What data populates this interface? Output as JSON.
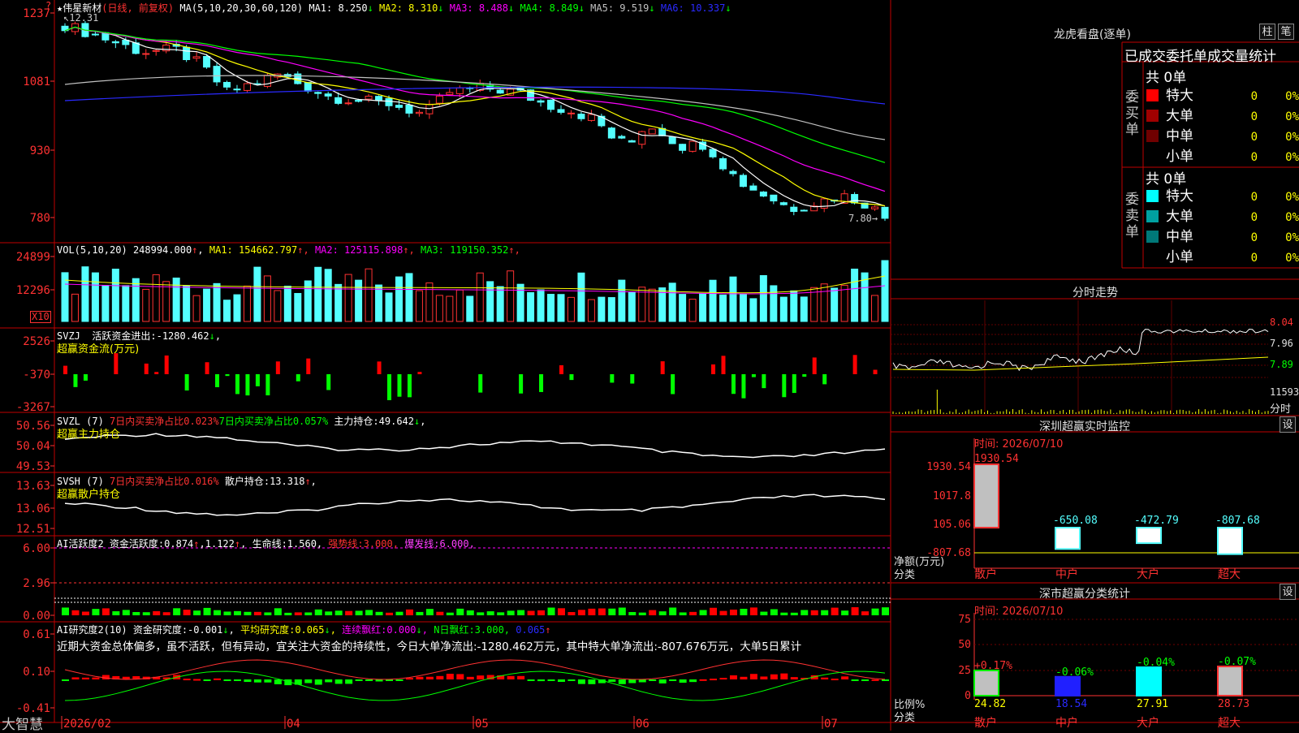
{
  "colors": {
    "up": "#ff3232",
    "down": "#54ffff",
    "ma1": "#ffffff",
    "ma2": "#ffff00",
    "ma3": "#ff00ff",
    "ma4": "#00ff00",
    "ma5": "#c0c0c0",
    "ma6": "#2a2aff",
    "frame": "#c00000",
    "axis": "#ff3232"
  },
  "main_panel": {
    "stock_name": "伟星新材",
    "period_adjust": "(日线, 前复权)",
    "ma_header": "MA(5,10,20,30,60,120)",
    "ma": [
      {
        "label": "MA1:",
        "value": "8.250",
        "arrow": "↓",
        "color": "#ffffff"
      },
      {
        "label": "MA2:",
        "value": "8.310",
        "arrow": "↓",
        "color": "#ffff00"
      },
      {
        "label": "MA3:",
        "value": "8.488",
        "arrow": "↓",
        "color": "#ff00ff"
      },
      {
        "label": "MA4:",
        "value": "8.849",
        "arrow": "↓",
        "color": "#00ff00"
      },
      {
        "label": "MA5:",
        "value": "9.519",
        "arrow": "↓",
        "color": "#c0c0c0"
      },
      {
        "label": "MA6:",
        "value": "10.337",
        "arrow": "↓",
        "color": "#2a2aff"
      }
    ],
    "high_marker": "12.31",
    "low_marker": "7.80→",
    "y_ticks": [
      "1237",
      "1081",
      "930",
      "780"
    ],
    "top_left_icon": "?"
  },
  "vol_panel": {
    "title": "VOL(5,10,20)",
    "value": "248994.000",
    "ma": [
      {
        "label": "MA1:",
        "value": "154662.797",
        "color": "#ffff00"
      },
      {
        "label": "MA2:",
        "value": "125115.898",
        "color": "#ff00ff"
      },
      {
        "label": "MA3:",
        "value": "119150.352",
        "color": "#00ff00"
      }
    ],
    "y_ticks": [
      "24899",
      "12296"
    ],
    "unit": "X10"
  },
  "svzj_panel": {
    "title": "SVZJ",
    "label": "活跃资金进出:",
    "value": "-1280.462",
    "subtitle": "超赢资金流(万元)",
    "y_ticks": [
      "2526",
      "-370",
      "-3267"
    ]
  },
  "svzl_panel": {
    "title": "SVZL (7)",
    "label1": "7日内买卖净占比0.023%",
    "label2": "7日内买卖净占比0.057%",
    "label3": "主力持仓:",
    "value": "49.642",
    "subtitle": "超赢主力持仓",
    "y_ticks": [
      "50.56",
      "50.04",
      "49.53"
    ]
  },
  "svsh_panel": {
    "title": "SVSH (7)",
    "label1": "7日内买卖净占比0.016%",
    "label2": "散户持仓:",
    "value": "13.318",
    "subtitle": "超赢散户持仓",
    "y_ticks": [
      "13.63",
      "13.06",
      "12.51"
    ]
  },
  "ai1_panel": {
    "title": "AI活跃度2",
    "label": "资金活跃度:",
    "value1": "0.874",
    "value2": "1.122",
    "life_label": "生命线:",
    "life_value": "1.560",
    "strong_label": "强势线:",
    "strong_value": "3.000",
    "burst_label": "爆发线:",
    "burst_value": "6.000",
    "y_ticks": [
      "6.00",
      "2.96",
      "0.00"
    ]
  },
  "ai2_panel": {
    "title": "AI研究度2(10)",
    "label1": "资金研究度:",
    "value1": "-0.001",
    "label2": "平均研究度:",
    "value2": "0.065",
    "label3": "连续飘红:",
    "value3": "0.000",
    "label4": "N日飘红:",
    "value4": "3.000",
    "value5": "0.065",
    "commentary": "近期大资金总体偏多，虽不活跃，但有异动，宜关注大资金的持续性，今日大单净流出:-1280.462万元，其中特大单净流出:-807.676万元，大单5日累计",
    "y_ticks": [
      "0.61",
      "0.10",
      "-0.41"
    ]
  },
  "x_axis": {
    "labels": [
      "2026/02",
      "04",
      "05",
      "06",
      "07"
    ],
    "brand": "大智慧"
  },
  "dragon": {
    "title": "龙虎看盘(逐单)",
    "btn_bar": "柱",
    "btn_pen": "笔",
    "header": "已成交委托单成交量统计",
    "buy_label": "委买单",
    "sell_label": "委卖单",
    "buy_total": "共 0单",
    "sell_total": "共 0单",
    "buy_rows": [
      {
        "label": "特大",
        "count": "0",
        "pct": "0%",
        "color": "#ff0000"
      },
      {
        "label": "大单",
        "count": "0",
        "pct": "0%",
        "color": "#a00000"
      },
      {
        "label": "中单",
        "count": "0",
        "pct": "0%",
        "color": "#700000"
      },
      {
        "label": "小单",
        "count": "0",
        "pct": "0%",
        "color": ""
      }
    ],
    "sell_rows": [
      {
        "label": "特大",
        "count": "0",
        "pct": "0%",
        "color": "#00ffff"
      },
      {
        "label": "大单",
        "count": "0",
        "pct": "0%",
        "color": "#00a0a0"
      },
      {
        "label": "中单",
        "count": "0",
        "pct": "0%",
        "color": "#007878"
      },
      {
        "label": "小单",
        "count": "0",
        "pct": "0%",
        "color": ""
      }
    ]
  },
  "intraday": {
    "title": "分时走势",
    "y_ticks": [
      "8.04",
      "7.96",
      "7.89"
    ],
    "vol_tick": "11593",
    "vol_label": "分时"
  },
  "sz_monitor": {
    "title": "深圳超赢实时监控",
    "btn": "设",
    "time": "时间: 2026/07/10",
    "y_ticks": [
      "1930.54",
      "1017.8",
      "105.06",
      "-807.68"
    ],
    "bars": [
      {
        "cat": "散户",
        "value": 1930.54,
        "label": "1930.54"
      },
      {
        "cat": "中户",
        "value": -650.08,
        "label": "-650.08"
      },
      {
        "cat": "大户",
        "value": -472.79,
        "label": "-472.79"
      },
      {
        "cat": "超大",
        "value": -807.68,
        "label": "-807.68"
      }
    ],
    "axis_label": "净额(万元)",
    "cat_label": "分类"
  },
  "sz_stats": {
    "title": "深市超赢分类统计",
    "btn": "设",
    "time": "时间: 2026/07/10",
    "y_ticks": [
      "75",
      "50",
      "25",
      "0"
    ],
    "bars": [
      {
        "cat": "散户",
        "value": 24.82,
        "change": "+0.17%",
        "label": "24.82"
      },
      {
        "cat": "中户",
        "value": 18.54,
        "change": "-0.06%",
        "label": "18.54"
      },
      {
        "cat": "大户",
        "value": 27.91,
        "change": "-0.04%",
        "label": "27.91"
      },
      {
        "cat": "超大",
        "value": 28.73,
        "change": "-0.07%",
        "label": "28.73"
      }
    ],
    "axis_label": "比例%",
    "cat_label": "分类"
  }
}
